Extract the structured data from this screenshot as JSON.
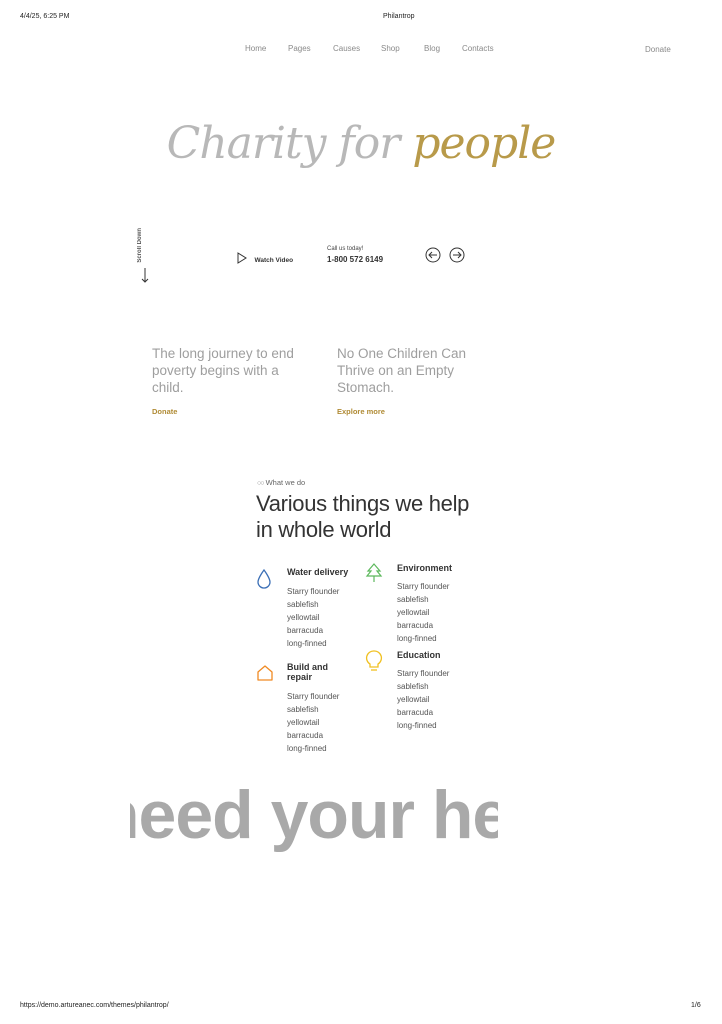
{
  "print_header": {
    "datetime": "4/4/25, 6:25 PM",
    "title": "Philantrop"
  },
  "nav": {
    "items": [
      "Home",
      "Pages",
      "Causes",
      "Shop",
      "Blog",
      "Contacts"
    ],
    "donate": "Donate"
  },
  "hero": {
    "title_part1": "Charity for",
    "title_part2": "people",
    "scroll_label": "Scroll Down"
  },
  "actions": {
    "watch_video": "Watch Video",
    "call_label": "Call us today!",
    "phone": "1-800 572 6149"
  },
  "cards": [
    {
      "title": "The long journey to end poverty begins with a child.",
      "link": "Donate"
    },
    {
      "title": "No One Children Can Thrive on an Empty Stomach.",
      "link": "Explore more"
    }
  ],
  "what_we_do": {
    "eyebrow": "What we do",
    "heading": "Various things we help in whole world",
    "services": [
      {
        "title": "Water delivery",
        "icon": "drop-icon",
        "color": "#3b6fb6",
        "lines": [
          "Starry flounder",
          "sablefish",
          "yellowtail",
          "barracuda",
          "long-finned"
        ]
      },
      {
        "title": "Environment",
        "icon": "tree-icon",
        "color": "#5cb85c",
        "lines": [
          "Starry flounder",
          "sablefish",
          "yellowtail",
          "barracuda",
          "long-finned"
        ]
      },
      {
        "title": "Build and repair",
        "icon": "house-icon",
        "color": "#f08a24",
        "lines": [
          "Starry flounder",
          "sablefish",
          "yellowtail",
          "barracuda",
          "long-finned"
        ]
      },
      {
        "title": "Education",
        "icon": "lightbulb-icon",
        "color": "#f0c020",
        "lines": [
          "Starry flounder",
          "sablefish",
          "yellowtail",
          "barracuda",
          "long-finned"
        ]
      }
    ]
  },
  "marquee": {
    "text": "need your help"
  },
  "print_footer": {
    "url": "https://demo.artureanec.com/themes/philantrop/",
    "page": "1/6"
  }
}
